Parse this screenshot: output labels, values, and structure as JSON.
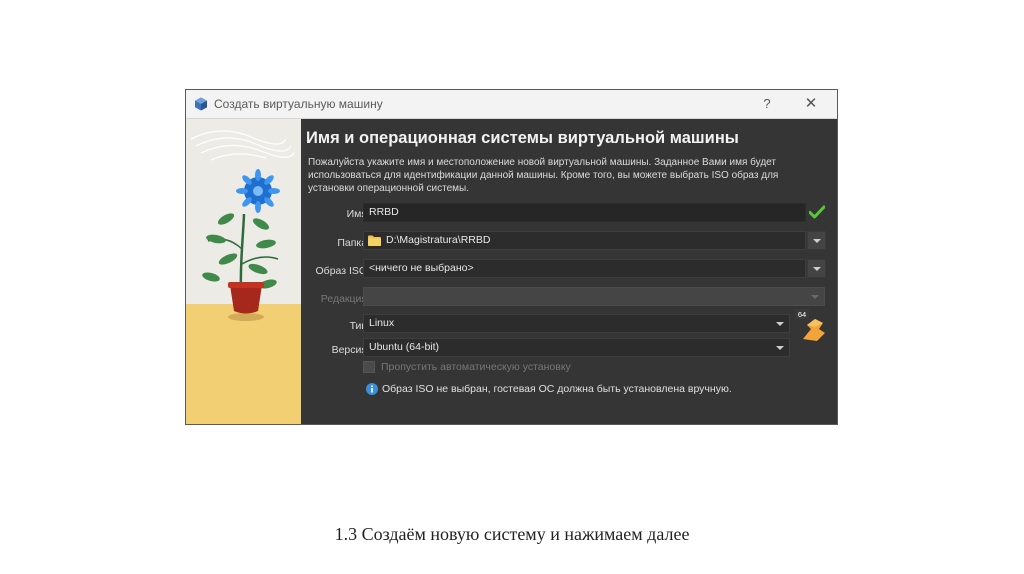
{
  "window": {
    "title": "Создать виртуальную машину",
    "help_label": "?",
    "close_label": "✕"
  },
  "page": {
    "heading": "Имя и операционная системы виртуальной машины",
    "description": "Пожалуйста укажите имя и местоположение новой виртуальной машины. Заданное Вами имя будет использоваться для идентификации данной машины. Кроме того, вы можете выбрать ISO образ для установки операционной системы."
  },
  "form": {
    "name_label": "Имя:",
    "name_value": "RRBD",
    "folder_label": "Папка:",
    "folder_value": "D:\\Magistratura\\RRBD",
    "iso_label": "Образ ISO:",
    "iso_value": "<ничего не выбрано>",
    "edition_label": "Редакция:",
    "edition_value": "",
    "type_label": "Тип:",
    "type_value": "Linux",
    "version_label": "Версия:",
    "version_value": "Ubuntu (64-bit)",
    "skip_unattended_label": "Пропустить автоматическую установку",
    "info_text": "Образ ISO не выбран, гостевая ОС должна быть установлена вручную.",
    "os_badge": "64"
  },
  "icons": {
    "app": "virtualbox-icon",
    "folder": "folder-icon",
    "valid": "check-icon",
    "info": "info-icon",
    "os": "linux-os-icon"
  },
  "colors": {
    "dialog_bg": "#353535",
    "titlebar_bg": "#f3f3f3",
    "field_bg": "#262626",
    "valid_green": "#58c738",
    "info_blue": "#3b8fd9",
    "art_floor": "#f3cf73",
    "art_wall": "#ecebe6"
  },
  "caption": "1.3 Создаём новую систему и нажимаем далее"
}
